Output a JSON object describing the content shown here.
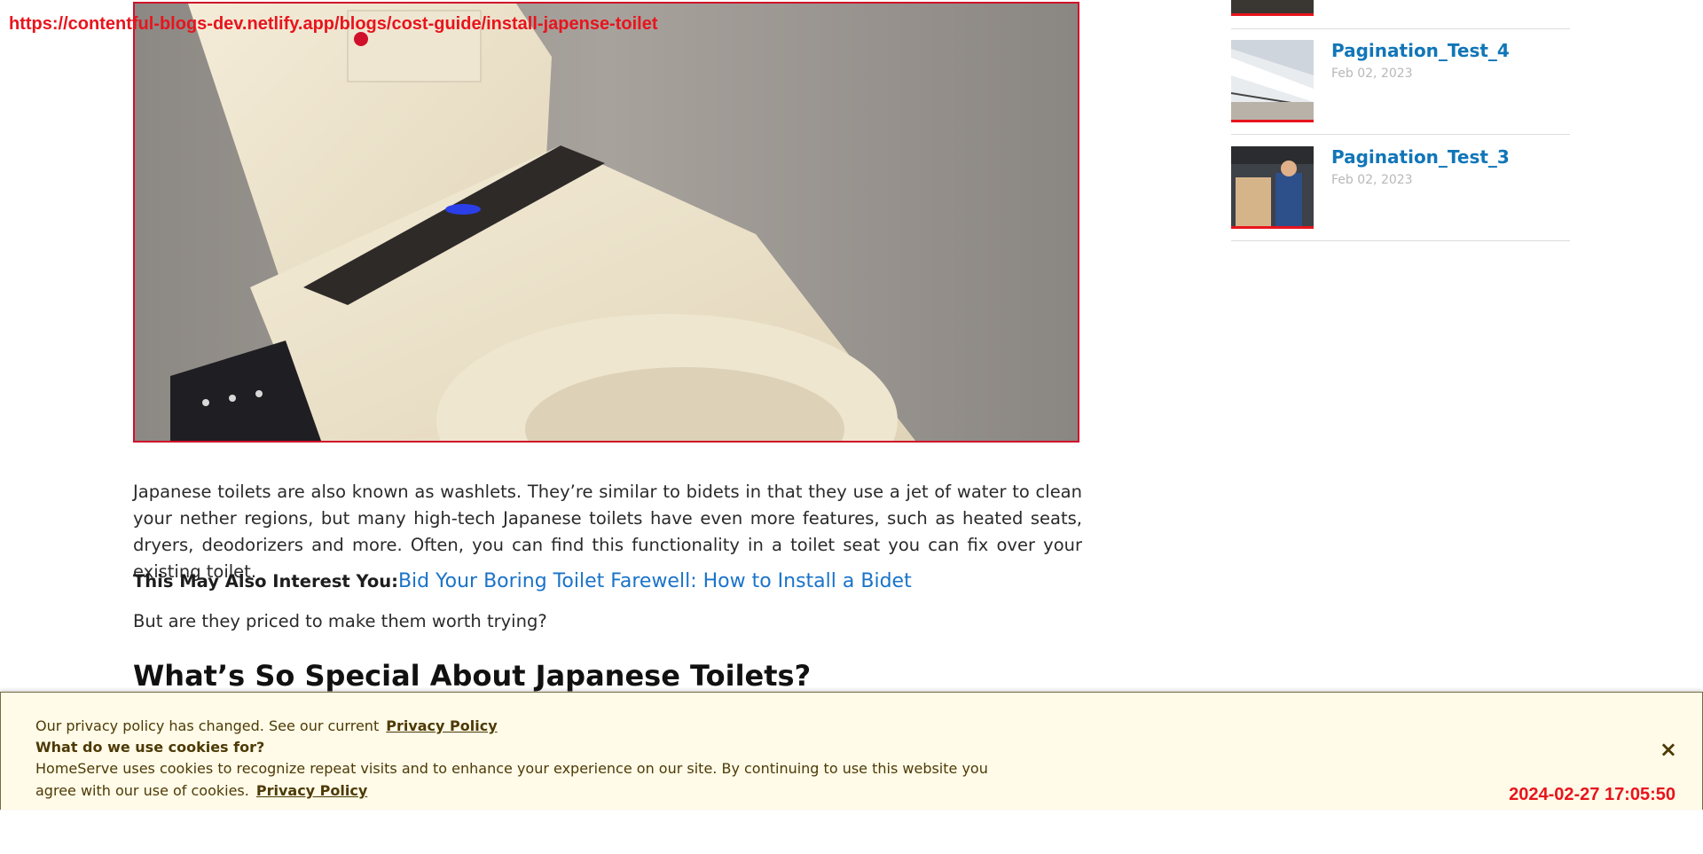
{
  "overlay": {
    "url": "https://contentful-blogs-dev.netlify.app/blogs/cost-guide/install-japense-toilet",
    "timestamp": "2024-02-27 17:05:50"
  },
  "article": {
    "hero_alt": "Japanese toilet with washlet seat",
    "paragraph": "Japanese toilets are also known as washlets. They’re similar to bidets in that they use a jet of water to clean your nether regions, but many high-tech Japanese toilets have even more features, such as heated seats, dryers, deodorizers and more. Often, you can find this functionality in a toilet seat you can fix over your existing toilet.",
    "interest_lead": "This May Also Interest You:",
    "interest_link": "Bid Your Boring Toilet Farewell: How to Install a Bidet",
    "question": "But are they priced to make them worth trying?",
    "heading": "What’s So Special About Japanese Toilets?"
  },
  "sidebar": {
    "items": [
      {
        "title": "Pagination_Test_4",
        "date": "Feb 02, 2023"
      },
      {
        "title": "Pagination_Test_3",
        "date": "Feb 02, 2023"
      }
    ]
  },
  "cookie_banner": {
    "policy_changed": "Our privacy policy has changed. See our current",
    "policy_link": "Privacy Policy",
    "question": "What do we use cookies for?",
    "body_line1": "HomeServe uses cookies to recognize repeat visits and to enhance your experience on our site. By continuing to use this website you",
    "body_line2": "agree with our use of cookies.",
    "policy_link2": "Privacy Policy",
    "close_icon": "×"
  },
  "colors": {
    "accent_red": "#e8141d",
    "link_blue": "#1a73c9",
    "sidebar_title_blue": "#1176b8",
    "banner_bg": "#fffbe8",
    "banner_text": "#4d3a06"
  }
}
